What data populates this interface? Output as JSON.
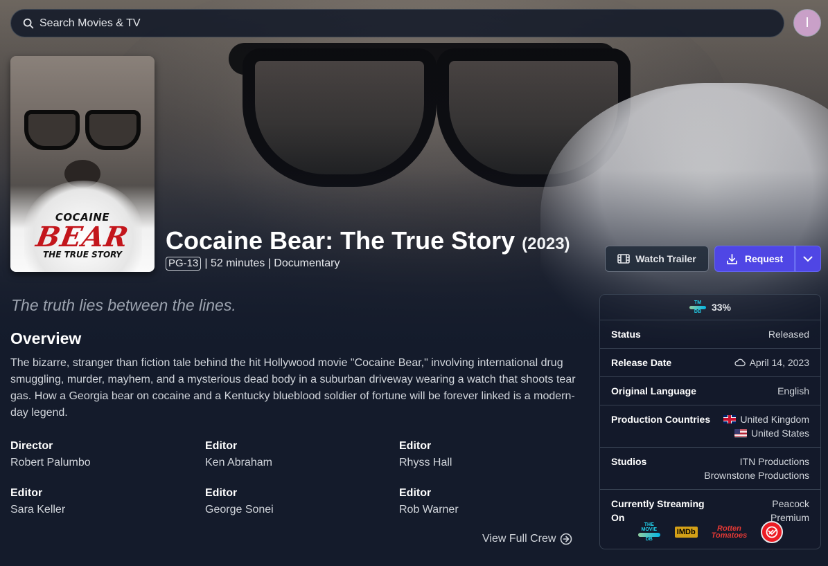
{
  "search": {
    "placeholder": "Search Movies & TV"
  },
  "user": {
    "avatar_initial": "I"
  },
  "poster": {
    "line1": "COCAINE",
    "line2": "BEAR",
    "line3": "THE TRUE STORY"
  },
  "movie": {
    "title": "Cocaine Bear: The True Story",
    "year": "(2023)",
    "rating": "PG-13",
    "runtime": "52 minutes",
    "genre": "Documentary",
    "separator": "|",
    "tagline": "The truth lies between the lines.",
    "overview_heading": "Overview",
    "overview": "The bizarre, stranger than fiction tale behind the hit Hollywood movie \"Cocaine Bear,\" involving international drug smuggling, murder, mayhem, and a mysterious dead body in a suburban driveway wearing a watch that shoots tear gas. How a Georgia bear on cocaine and a Kentucky blueblood soldier of fortune will be forever linked is a modern-day legend."
  },
  "actions": {
    "watch_trailer": "Watch Trailer",
    "request": "Request"
  },
  "crew": [
    {
      "job": "Director",
      "name": "Robert Palumbo"
    },
    {
      "job": "Editor",
      "name": "Ken Abraham"
    },
    {
      "job": "Editor",
      "name": "Rhyss Hall"
    },
    {
      "job": "Editor",
      "name": "Sara Keller"
    },
    {
      "job": "Editor",
      "name": "George Sonei"
    },
    {
      "job": "Editor",
      "name": "Rob Warner"
    }
  ],
  "view_full_crew": "View Full Crew",
  "details": {
    "tmdb_logo_top": "TM",
    "tmdb_logo_bottom": "DB",
    "tmdb_score": "33%",
    "status_label": "Status",
    "status_value": "Released",
    "release_label": "Release Date",
    "release_value": "April 14, 2023",
    "language_label": "Original Language",
    "language_value": "English",
    "countries_label": "Production Countries",
    "countries": [
      "United Kingdom",
      "United States"
    ],
    "studios_label": "Studios",
    "studios": [
      "ITN Productions",
      "Brownstone Productions"
    ],
    "streaming_label_1": "Currently Streaming",
    "streaming_label_2": "On",
    "streaming_value_1": "Peacock",
    "streaming_value_2": "Premium"
  },
  "logos": {
    "tmdb_1": "THE",
    "tmdb_2": "MOVIE",
    "tmdb_3": "DB",
    "imdb": "IMDb",
    "rt_1": "Rotten",
    "rt_2": "Tomatoes"
  },
  "colors": {
    "accent": "#4f46e5",
    "background": "#141b2b",
    "panel_border": "#374151"
  }
}
